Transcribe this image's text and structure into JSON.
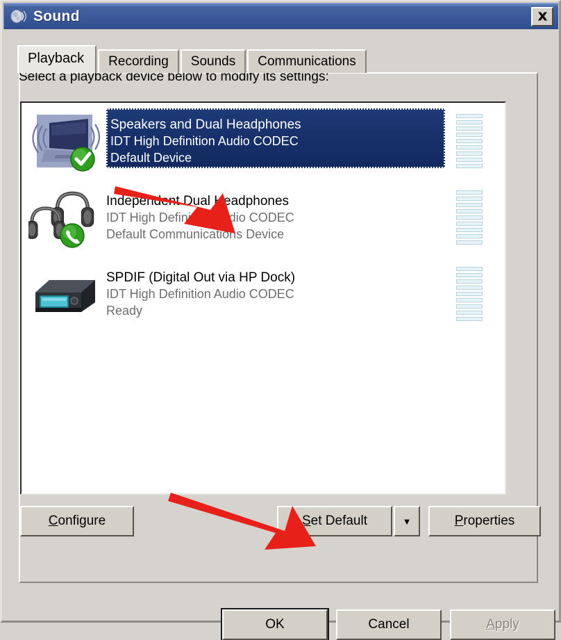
{
  "window": {
    "title": "Sound",
    "title_icon": "speaker-icon",
    "close_label": "✕"
  },
  "tabs": [
    {
      "label": "Playback",
      "active": true
    },
    {
      "label": "Recording",
      "active": false
    },
    {
      "label": "Sounds",
      "active": false
    },
    {
      "label": "Communications",
      "active": false
    }
  ],
  "main": {
    "instruction": "Select a playback device below to modify its settings:"
  },
  "devices": [
    {
      "name": "Speakers and Dual Headphones",
      "driver": "IDT High Definition Audio CODEC",
      "status": "Default Device",
      "icon": "laptop-speakers-icon",
      "badge": "green-check-badge",
      "selected": true,
      "meter_segments": 9
    },
    {
      "name": "Independent Dual Headphones",
      "driver": "IDT High Definition Audio CODEC",
      "status": "Default Communications Device",
      "icon": "dual-headphones-icon",
      "badge": "green-phone-badge",
      "selected": false,
      "meter_segments": 9
    },
    {
      "name": "SPDIF (Digital Out via HP Dock)",
      "driver": "IDT High Definition Audio CODEC",
      "status": "Ready",
      "icon": "spdif-device-icon",
      "badge": "none",
      "selected": false,
      "meter_segments": 9
    }
  ],
  "device_buttons": {
    "configure": {
      "accel": "C",
      "rest": "onfigure"
    },
    "set_default": {
      "accel": "S",
      "rest": "et Default"
    },
    "set_default_arrow": "▼",
    "properties": {
      "accel": "P",
      "rest": "roperties"
    }
  },
  "dialog_buttons": {
    "ok": "OK",
    "cancel": "Cancel",
    "apply": {
      "accel": "A",
      "rest": "pply",
      "disabled": true
    }
  },
  "colors": {
    "titlebar_blue": "#3c589a",
    "selection_blue": "#17306a",
    "face": "#d4d0c8",
    "annotation_red": "#e8201a",
    "meter_fill": "#e8f3f8"
  }
}
